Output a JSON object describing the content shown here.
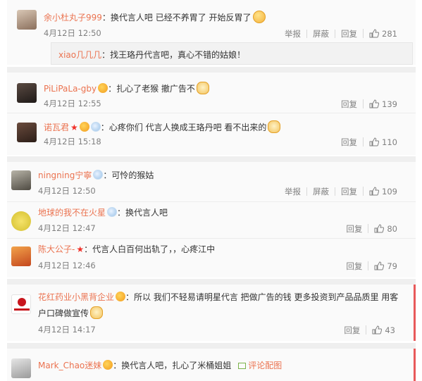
{
  "comments": [
    {
      "user": "余小杜丸子999",
      "text": "：换代言人吧 已经不养胃了 开始反胃了",
      "time": "4月12日 12:50",
      "actions": [
        "举报",
        "屏蔽",
        "回复"
      ],
      "likes": "281",
      "reply": {
        "user": "xiao几几几",
        "text": "：找王珞丹代言吧，真心不错的姑娘！"
      }
    },
    {
      "user": "PiLiPaLa-gby",
      "text": "：扎心了老猴 撤广告不",
      "time": "4月12日 12:55",
      "actions": [
        "回复"
      ],
      "likes": "139"
    },
    {
      "user": "诺瓦君",
      "text": "：心疼你们 代言人换成王珞丹吧 看不出来的",
      "time": "4月12日 15:18",
      "actions": [
        "回复"
      ],
      "likes": "110"
    },
    {
      "user": "ningning宁寧",
      "text": "：可怜的猴姑",
      "time": "4月12日 12:50",
      "actions": [
        "举报",
        "屏蔽",
        "回复"
      ],
      "likes": "109"
    },
    {
      "user": "地球的我不在火星",
      "text": "：换代言人吧",
      "time": "4月12日 12:47",
      "actions": [
        "回复"
      ],
      "likes": "80"
    },
    {
      "user": "陈大公子-",
      "text": "：代言人白百何出轨了，，心疼江中",
      "time": "4月12日 12:46",
      "actions": [
        "回复"
      ],
      "likes": "79"
    },
    {
      "user": "花红药业小黑背企业",
      "text": "：所以 我们不轻易请明星代言 把做广告的钱 更多投资到产品品质里 用客",
      "text2": "户口碑做宣传",
      "time": "4月12日 14:17",
      "actions": [
        "回复"
      ],
      "likes": "43"
    },
    {
      "user": "Mark_Chao迷妹",
      "text": "：换代言人吧，扎心了米桶姐姐",
      "picture_link": "评论配图"
    }
  ],
  "colors": {
    "username": "#eb7350",
    "accent_bar": "#e8595a",
    "meta": "#808080"
  },
  "icons": {
    "like": "thumbs-up-icon",
    "picture": "picture-icon"
  }
}
